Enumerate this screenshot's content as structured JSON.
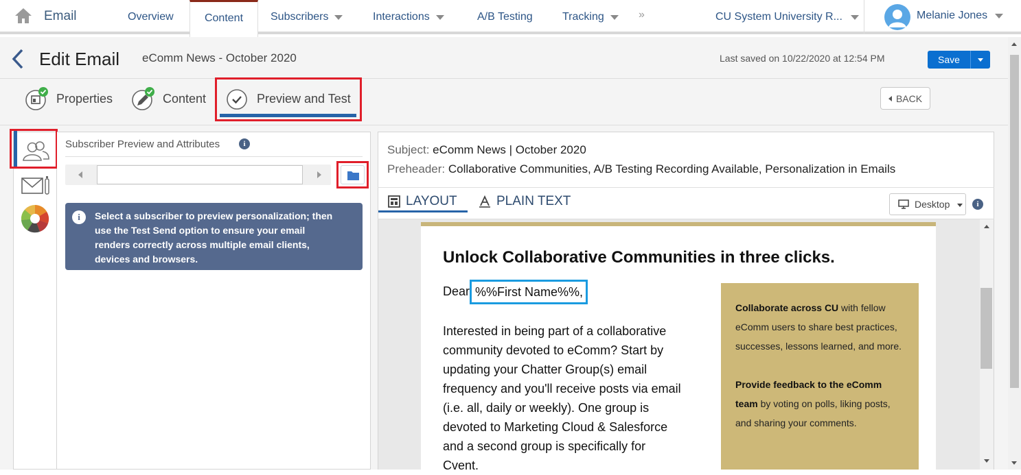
{
  "topnav": {
    "app_name": "Email",
    "tabs": [
      {
        "label": "Overview",
        "active": false,
        "dropdown": false
      },
      {
        "label": "Content",
        "active": true,
        "dropdown": false
      },
      {
        "label": "Subscribers",
        "active": false,
        "dropdown": true
      },
      {
        "label": "Interactions",
        "active": false,
        "dropdown": true
      },
      {
        "label": "A/B Testing",
        "active": false,
        "dropdown": false
      },
      {
        "label": "Tracking",
        "active": false,
        "dropdown": true
      }
    ],
    "more": "»",
    "business_unit": "CU System University R...",
    "user_name": "Melanie Jones"
  },
  "header": {
    "title": "Edit Email",
    "email_name": "eComm News - October 2020",
    "last_saved": "Last saved on 10/22/2020 at 12:54 PM",
    "save_label": "Save"
  },
  "steps": {
    "properties": "Properties",
    "content": "Content",
    "preview": "Preview and Test",
    "back_label": "BACK"
  },
  "left_panel": {
    "title": "Subscriber Preview and Attributes",
    "subscriber_value": "",
    "info_text": "Select a subscriber to preview personalization; then use the Test Send option to ensure your email renders correctly across multiple email clients, devices and browsers."
  },
  "preview": {
    "subject_label": "Subject:",
    "subject": "eComm News | October 2020",
    "preheader_label": "Preheader:",
    "preheader": "Collaborative Communities, A/B Testing Recording Available, Personalization in Emails",
    "tab_layout": "LAYOUT",
    "tab_plain": "PLAIN TEXT",
    "device": "Desktop"
  },
  "email": {
    "heading": "Unlock Collaborative Communities in three clicks.",
    "dear": "Dear",
    "merge_field": "%%First Name%%,",
    "paragraph": "Interested in being part of a collaborative community devoted to eComm? Start by updating your Chatter Group(s) email frequency and you'll receive posts via email (i.e. all, daily or weekly). One group is devoted to Marketing Cloud & Salesforce and a second group is specifically for Cvent.",
    "callout_1_bold": "Collaborate across CU",
    "callout_1_rest": " with fellow eComm users to share best practices, successes, lessons learned, and more.",
    "callout_2_bold": "Provide feedback to the eComm team",
    "callout_2_rest": " by voting on polls, liking posts, and sharing your comments."
  },
  "colors": {
    "brand_blue": "#0b6fd0",
    "nav_text": "#2d5586",
    "highlight_red": "#e01e2a",
    "merge_blue": "#1a9be0",
    "callout_gold": "#cdb878",
    "info_box": "#55698e"
  },
  "icons": {
    "home": "home-icon",
    "back": "chevron-left-icon",
    "properties": "properties-icon",
    "content": "pencil-icon",
    "preview": "check-circle-icon",
    "users": "users-icon",
    "email_test": "email-test-icon",
    "color_wheel": "color-wheel-icon",
    "folder": "folder-icon",
    "info": "info-icon",
    "desktop": "desktop-icon"
  }
}
